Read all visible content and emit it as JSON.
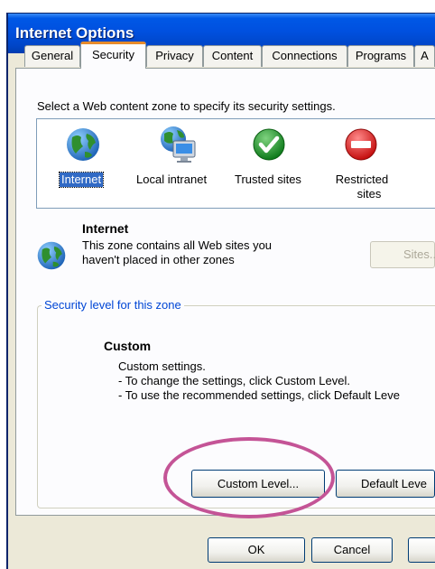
{
  "window": {
    "title": "Internet Options"
  },
  "tabs": [
    "General",
    "Security",
    "Privacy",
    "Content",
    "Connections",
    "Programs",
    "A"
  ],
  "security": {
    "instruction": "Select a Web content zone to specify its security settings.",
    "zones": [
      {
        "label": "Internet",
        "icon": "globe-icon"
      },
      {
        "label": "Local intranet",
        "icon": "intranet-icon"
      },
      {
        "label": "Trusted sites",
        "icon": "checkmark-icon"
      },
      {
        "label_line1": "Restricted",
        "label_line2": "sites",
        "icon": "no-entry-icon"
      }
    ],
    "selected_zone": {
      "name": "Internet",
      "desc_line1": "This zone contains all Web sites you",
      "desc_line2": "haven't placed in other zones"
    },
    "sites_button": "Sites..."
  },
  "level": {
    "group_label": "Security level for this zone",
    "title": "Custom",
    "line1": "Custom settings.",
    "line2": "- To change the settings, click Custom Level.",
    "line3": "- To use the recommended settings, click Default Leve",
    "custom_button": "Custom Level...",
    "default_button": "Default Leve"
  },
  "footer": {
    "ok": "OK",
    "cancel": "Cancel"
  },
  "colors": {
    "title_bar": "#0050df",
    "highlight": "#c45496",
    "selection": "#316ac5"
  }
}
